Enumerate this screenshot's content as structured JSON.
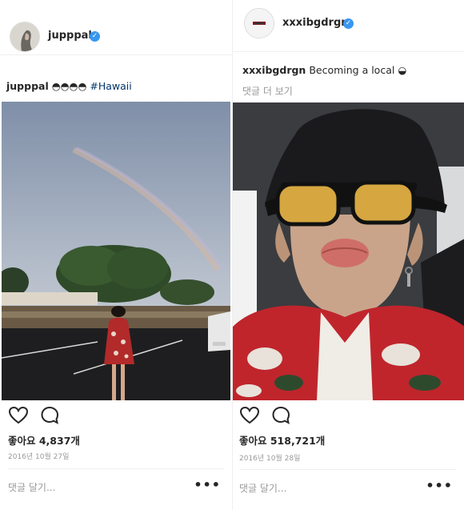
{
  "posts": [
    {
      "username": "jupppal",
      "caption_user": "jupppal",
      "caption_text": "◓◓◓◓",
      "caption_hashtag": "#Hawaii",
      "likes_text": "좋아요 4,837개",
      "date": "2016년 10월 27일",
      "comment_placeholder": "댓글 달기...",
      "more": "•••"
    },
    {
      "username": "xxxibgdrgn",
      "caption_user": "xxxibgdrgn",
      "caption_text": "Becoming a local",
      "caption_emoji": "◒",
      "view_comments": "댓글 더 보기",
      "likes_text": "좋아요 518,721개",
      "date": "2016년 10월 28일",
      "comment_placeholder": "댓글 달기...",
      "more": "•••"
    }
  ],
  "colors": {
    "verified": "#3897f0",
    "hashtag": "#003569",
    "muted": "#999999"
  }
}
